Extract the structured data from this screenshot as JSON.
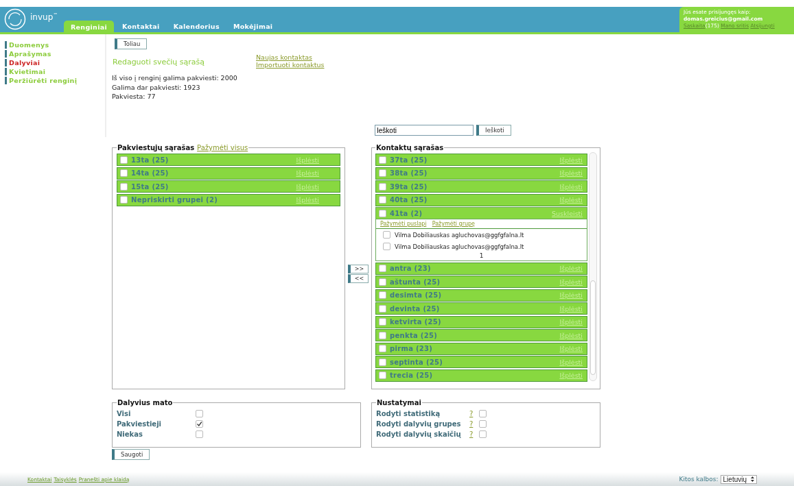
{
  "header": {
    "logo_text": "invup",
    "logo_mark": "™",
    "tabs": [
      {
        "label": "Renginiai",
        "selected": true
      },
      {
        "label": "Kontaktai",
        "selected": false
      },
      {
        "label": "Kalendorius",
        "selected": false
      },
      {
        "label": "Mokėjimai",
        "selected": false
      }
    ],
    "user": {
      "intro": "Jūs esate prisijungęs kaip:",
      "email": "domas.greicius@gmail.com",
      "account_link": "Sąskaita",
      "count": "(175)",
      "links": [
        "Mano sritis",
        "Atsijungti"
      ]
    }
  },
  "sidebar": {
    "items": [
      {
        "label": "Duomenys",
        "selected": false
      },
      {
        "label": "Aprašymas",
        "selected": false
      },
      {
        "label": "Dalyviai",
        "selected": true
      },
      {
        "label": "Kvietimai",
        "selected": false
      },
      {
        "label": "Peržiūrėti renginį",
        "selected": false
      }
    ]
  },
  "next_button": "Toliau",
  "links": [
    "Naujas kontaktas",
    "Importuoti kontaktus"
  ],
  "heading": "Redaguoti svečių sąrašą",
  "stats": [
    "Iš viso į renginį galima pakviesti: 2000",
    "Galima dar pakviesti: 1923",
    "Pakviesta: 77"
  ],
  "search": {
    "value": "Ieškoti",
    "button": "Ieškoti"
  },
  "invited": {
    "title": "Pakviestųjų sąrašas",
    "select_all": "Pažymėti visus",
    "groups": [
      {
        "label": "13ta (25)",
        "action": "Išplėsti",
        "checked": false
      },
      {
        "label": "14ta (25)",
        "action": "Išplėsti",
        "checked": false
      },
      {
        "label": "15ta (25)",
        "action": "Išplėsti",
        "checked": false
      },
      {
        "label": "Nepriskirti grupei (2)",
        "action": "Išplėsti",
        "checked": false
      }
    ]
  },
  "transfer_buttons": [
    ">>",
    "<<"
  ],
  "contacts": {
    "title": "Kontaktų sąrašas",
    "groups": [
      {
        "label": "37ta (25)",
        "action": "Išplėsti",
        "checked": false,
        "expanded": false
      },
      {
        "label": "38ta (25)",
        "action": "Išplėsti",
        "checked": false,
        "expanded": false
      },
      {
        "label": "39ta (25)",
        "action": "Išplėsti",
        "checked": false,
        "expanded": false
      },
      {
        "label": "40ta (25)",
        "action": "Išplėsti",
        "checked": false,
        "expanded": false
      },
      {
        "label": "41ta (2)",
        "action": "Suskleisti",
        "checked": false,
        "expanded": true,
        "select_links": [
          "Pažymėti puslapį",
          "Pažymėti grupę"
        ],
        "members": [
          {
            "text": "Vilma Dobiliauskas agluchovas@ggfgfalna.lt",
            "checked": false
          },
          {
            "text": "Vilma Dobiliauskas agluchovas@ggfgfalna.lt",
            "checked": false
          }
        ],
        "page": "1"
      },
      {
        "label": "antra (23)",
        "action": "Išplėsti",
        "checked": false,
        "expanded": false
      },
      {
        "label": "aštunta (25)",
        "action": "Išplėsti",
        "checked": false,
        "expanded": false
      },
      {
        "label": "desimta (25)",
        "action": "Išplėsti",
        "checked": false,
        "expanded": false
      },
      {
        "label": "devinta (25)",
        "action": "Išplėsti",
        "checked": false,
        "expanded": false
      },
      {
        "label": "ketvirta (25)",
        "action": "Išplėsti",
        "checked": false,
        "expanded": false
      },
      {
        "label": "penkta (25)",
        "action": "Išplėsti",
        "checked": false,
        "expanded": false
      },
      {
        "label": "pirma (23)",
        "action": "Išplėsti",
        "checked": false,
        "expanded": false
      },
      {
        "label": "septinta (25)",
        "action": "Išplėsti",
        "checked": false,
        "expanded": false
      },
      {
        "label": "trecia (25)",
        "action": "Išplėsti",
        "checked": false,
        "expanded": false
      }
    ]
  },
  "visibility": {
    "title": "Dalyvius mato",
    "options": [
      {
        "label": "Visi",
        "checked": false
      },
      {
        "label": "Pakviestieji",
        "checked": true
      },
      {
        "label": "Niekas",
        "checked": false
      }
    ]
  },
  "settings": {
    "title": "Nustatymai",
    "options": [
      {
        "label": "Rodyti statistiką",
        "help": "?",
        "checked": false
      },
      {
        "label": "Rodyti dalyvių grupes",
        "help": "?",
        "checked": false
      },
      {
        "label": "Rodyti dalyvių skaičių",
        "help": "?",
        "checked": false
      }
    ]
  },
  "save_button": "Saugoti",
  "footer": {
    "links": [
      "Kontaktai",
      "Taisyklės",
      "Pranešti apie klaidą"
    ],
    "language_label": "Kitos kalbos:",
    "language": "Lietuvių"
  }
}
